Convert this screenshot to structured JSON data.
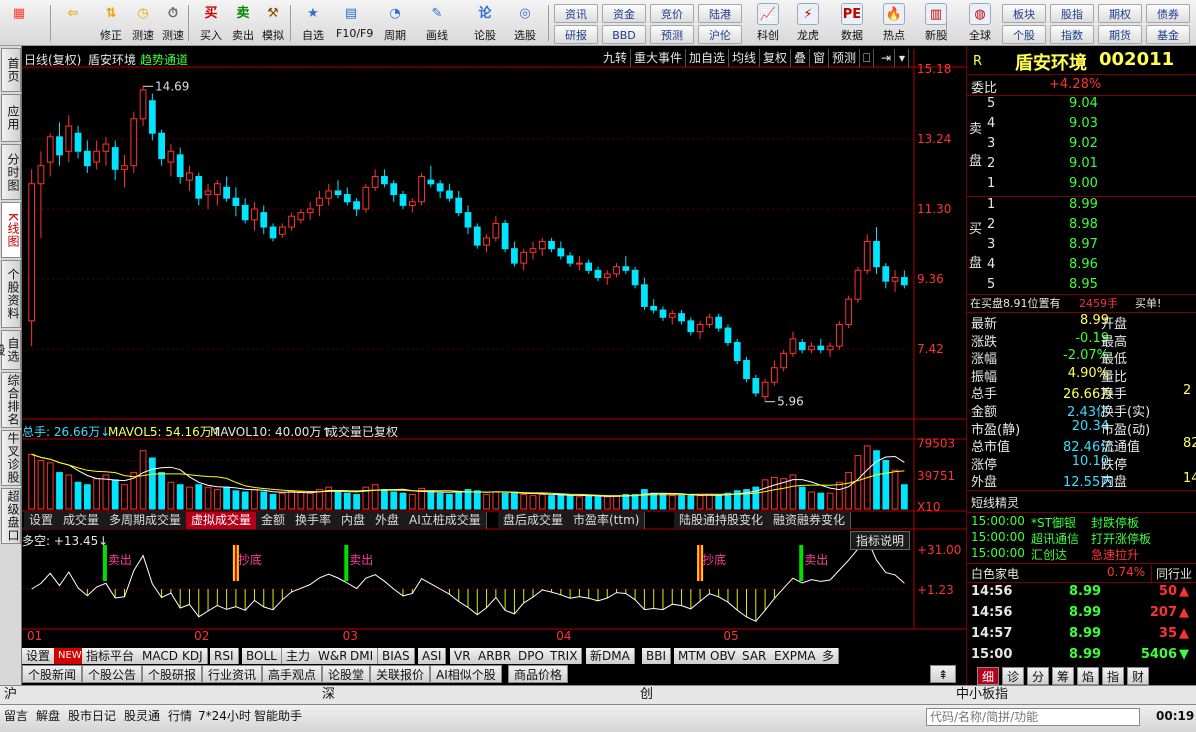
{
  "toolbar": {
    "buttons": [
      {
        "label": "",
        "icon": "grid-app-icon",
        "color": "#ff3b2f"
      },
      {
        "label": "",
        "icon": "back-arrow-icon",
        "color": "#f0a000"
      },
      {
        "label": "修正",
        "icon": "up-down-arrow-icon",
        "color": "#f0a000"
      },
      {
        "label": "测速",
        "icon": "clock-icon",
        "color": "#f0a000"
      },
      {
        "label": "测速",
        "icon": "stopwatch-icon",
        "color": "#606060"
      },
      {
        "label": "买入",
        "icon": "buy-icon",
        "color": "#d40000"
      },
      {
        "label": "卖出",
        "icon": "sell-icon",
        "color": "#008a00"
      },
      {
        "label": "模拟",
        "icon": "hammer-icon",
        "color": "#8a4a00"
      },
      {
        "label": "自选",
        "icon": "star-folder-icon",
        "color": "#2d6fd0"
      },
      {
        "label": "F10/F9",
        "icon": "f10-icon",
        "color": "#2d6fd0"
      },
      {
        "label": "周期",
        "icon": "cycle-icon",
        "color": "#2d6fd0"
      },
      {
        "label": "画线",
        "icon": "pencil-icon",
        "color": "#2d6fd0"
      },
      {
        "label": "论股",
        "icon": "discuss-icon",
        "color": "#2d6fd0"
      },
      {
        "label": "选股",
        "icon": "select-stock-icon",
        "color": "#2d6fd0"
      }
    ],
    "small_buttons": [
      "资讯",
      "资金",
      "竞价",
      "陆港",
      "研报",
      "BBD",
      "预测",
      "沪伦"
    ],
    "buttons2": [
      {
        "label": "科创",
        "icon": "kechuang-icon"
      },
      {
        "label": "龙虎",
        "icon": "dragon-tiger-icon"
      },
      {
        "label": "数据",
        "icon": "pe-data-icon"
      },
      {
        "label": "热点",
        "icon": "hotspot-icon"
      },
      {
        "label": "新股",
        "icon": "new-stock-icon"
      },
      {
        "label": "全球",
        "icon": "globe-icon"
      }
    ],
    "small_buttons2": [
      "板块",
      "股指",
      "期权",
      "债券",
      "个股",
      "指数",
      "期货",
      "基金"
    ]
  },
  "lefttabs": [
    "首页",
    "应用",
    "分时图",
    "K线图",
    "个股资料",
    "自选股",
    "综合排名",
    "牛叉诊股",
    "超级盘口"
  ],
  "chart": {
    "title": "日线(复权)",
    "stock": "盾安环境",
    "channel": "趋势通道",
    "top_buttons": [
      "九转",
      "重大事件",
      "加自选",
      "均线",
      "复权",
      "叠",
      "窗",
      "预测"
    ],
    "price_axis": [
      "15.18",
      "13.24",
      "11.30",
      "9.36",
      "7.42"
    ],
    "high_label": "14.69",
    "low_label": "5.96",
    "volume_header": {
      "total": "总手: 26.66万↓",
      "ma5": "MAVOL5: 54.16万↑",
      "ma10": "MAVOL10: 40.00万↑",
      "note": "成交量已复权"
    },
    "volume_axis": [
      "79503",
      "39751",
      "X10"
    ],
    "volume_tabs": [
      "设置",
      "成交量",
      "多周期成交量",
      "虚拟成交量",
      "金额",
      "换手率",
      "内盘",
      "外盘",
      "AI立桩成交量",
      "盘后成交量",
      "市盈率(ttm)",
      "陆股通持股变化",
      "融资融券变化"
    ],
    "active_volume_tab": "虚拟成交量",
    "indicator_header": "多空: +13.45↓",
    "indicator_help": "指标说明",
    "indicator_axis": [
      "+31.00",
      "+1.23"
    ],
    "signals": [
      "卖出",
      "抄底",
      "卖出",
      "抄底",
      "卖出"
    ],
    "months": [
      "01",
      "02",
      "03",
      "04",
      "05"
    ],
    "indicator_tabs": [
      "设置",
      "NEW",
      "指标平台",
      "MACD",
      "KDJ",
      "RSI",
      "BOLL",
      "主力",
      "W&R",
      "DMI",
      "BIAS",
      "ASI",
      "VR",
      "ARBR",
      "DPO",
      "TRIX",
      "新DMA",
      "BBI",
      "MTM",
      "OBV",
      "SAR",
      "EXPMA",
      "多"
    ],
    "colors": {
      "up": "#ff3232",
      "down": "#00e5ff",
      "axis": "#b40000",
      "ma5": "#ffffff",
      "ma10": "#ffff00"
    }
  },
  "candles": [
    [
      8.2,
      12.4,
      7.5,
      12.0
    ],
    [
      12.0,
      12.9,
      10.5,
      12.5
    ],
    [
      12.6,
      13.4,
      12.2,
      13.3
    ],
    [
      13.3,
      13.7,
      12.5,
      12.8
    ],
    [
      12.9,
      13.9,
      12.6,
      13.6
    ],
    [
      13.4,
      13.6,
      12.7,
      12.9
    ],
    [
      12.9,
      13.2,
      12.3,
      12.5
    ],
    [
      12.6,
      13.2,
      12.4,
      12.9
    ],
    [
      12.9,
      13.3,
      12.5,
      13.1
    ],
    [
      13.0,
      13.2,
      12.1,
      12.4
    ],
    [
      12.4,
      12.8,
      11.9,
      12.5
    ],
    [
      12.5,
      14.0,
      12.3,
      13.8
    ],
    [
      13.8,
      14.7,
      13.6,
      14.6
    ],
    [
      14.3,
      14.5,
      13.2,
      13.4
    ],
    [
      13.4,
      13.5,
      12.5,
      12.7
    ],
    [
      12.6,
      13.1,
      12.2,
      12.9
    ],
    [
      12.8,
      13.0,
      12.0,
      12.2
    ],
    [
      12.1,
      12.5,
      11.8,
      12.3
    ],
    [
      12.2,
      12.3,
      11.4,
      11.6
    ],
    [
      11.7,
      12.0,
      11.3,
      11.8
    ],
    [
      11.7,
      12.1,
      11.4,
      12.0
    ],
    [
      11.9,
      12.2,
      11.5,
      11.6
    ],
    [
      11.6,
      11.9,
      11.1,
      11.4
    ],
    [
      11.4,
      11.6,
      10.9,
      11.0
    ],
    [
      11.0,
      11.5,
      10.7,
      11.3
    ],
    [
      11.2,
      11.4,
      10.6,
      10.8
    ],
    [
      10.8,
      10.9,
      10.4,
      10.5
    ],
    [
      10.6,
      10.9,
      10.5,
      10.8
    ],
    [
      10.8,
      11.2,
      10.7,
      11.1
    ],
    [
      11.0,
      11.3,
      10.9,
      11.2
    ],
    [
      11.2,
      11.5,
      11.0,
      11.3
    ],
    [
      11.4,
      11.8,
      11.1,
      11.6
    ],
    [
      11.6,
      12.0,
      11.4,
      11.8
    ],
    [
      11.8,
      12.1,
      11.6,
      11.7
    ],
    [
      11.7,
      11.9,
      11.4,
      11.5
    ],
    [
      11.5,
      11.6,
      11.1,
      11.3
    ],
    [
      11.3,
      12.0,
      11.2,
      11.9
    ],
    [
      11.9,
      12.4,
      11.8,
      12.2
    ],
    [
      12.2,
      12.4,
      11.9,
      12.0
    ],
    [
      12.0,
      12.1,
      11.5,
      11.7
    ],
    [
      11.7,
      11.8,
      11.3,
      11.4
    ],
    [
      11.4,
      11.6,
      11.2,
      11.5
    ],
    [
      11.5,
      12.3,
      11.4,
      12.2
    ],
    [
      12.1,
      12.5,
      11.9,
      12.0
    ],
    [
      12.0,
      12.1,
      11.6,
      11.8
    ],
    [
      11.8,
      12.0,
      11.5,
      11.6
    ],
    [
      11.6,
      11.8,
      11.1,
      11.2
    ],
    [
      11.2,
      11.4,
      10.6,
      10.8
    ],
    [
      10.8,
      10.9,
      10.2,
      10.3
    ],
    [
      10.3,
      10.6,
      10.1,
      10.5
    ],
    [
      10.5,
      11.1,
      10.4,
      10.9
    ],
    [
      10.9,
      11.0,
      10.1,
      10.2
    ],
    [
      10.2,
      10.4,
      9.7,
      9.8
    ],
    [
      9.8,
      10.2,
      9.6,
      10.1
    ],
    [
      10.1,
      10.4,
      9.9,
      10.2
    ],
    [
      10.2,
      10.5,
      10.0,
      10.4
    ],
    [
      10.4,
      10.5,
      10.1,
      10.2
    ],
    [
      10.2,
      10.4,
      9.9,
      10.0
    ],
    [
      10.0,
      10.1,
      9.7,
      9.8
    ],
    [
      9.8,
      10.0,
      9.6,
      9.8
    ],
    [
      9.8,
      9.9,
      9.5,
      9.6
    ],
    [
      9.6,
      9.7,
      9.3,
      9.4
    ],
    [
      9.4,
      9.6,
      9.2,
      9.5
    ],
    [
      9.5,
      9.8,
      9.4,
      9.7
    ],
    [
      9.7,
      10.0,
      9.5,
      9.6
    ],
    [
      9.6,
      9.7,
      9.1,
      9.2
    ],
    [
      9.2,
      9.4,
      8.5,
      8.6
    ],
    [
      8.6,
      8.8,
      8.4,
      8.5
    ],
    [
      8.5,
      8.6,
      8.2,
      8.3
    ],
    [
      8.3,
      8.5,
      8.1,
      8.4
    ],
    [
      8.4,
      8.5,
      8.1,
      8.2
    ],
    [
      8.2,
      8.3,
      7.8,
      7.9
    ],
    [
      7.9,
      8.2,
      7.7,
      8.1
    ],
    [
      8.1,
      8.4,
      8.0,
      8.3
    ],
    [
      8.3,
      8.4,
      7.9,
      8.0
    ],
    [
      8.0,
      8.1,
      7.5,
      7.6
    ],
    [
      7.6,
      7.7,
      7.0,
      7.1
    ],
    [
      7.1,
      7.2,
      6.5,
      6.6
    ],
    [
      6.6,
      6.7,
      6.1,
      6.2
    ],
    [
      6.1,
      6.6,
      5.96,
      6.5
    ],
    [
      6.5,
      7.1,
      6.4,
      6.9
    ],
    [
      6.9,
      7.4,
      6.8,
      7.3
    ],
    [
      7.3,
      7.9,
      7.2,
      7.7
    ],
    [
      7.6,
      7.7,
      7.3,
      7.4
    ],
    [
      7.4,
      7.6,
      7.3,
      7.5
    ],
    [
      7.5,
      7.7,
      7.3,
      7.4
    ],
    [
      7.4,
      7.6,
      7.2,
      7.5
    ],
    [
      7.5,
      8.2,
      7.4,
      8.1
    ],
    [
      8.1,
      8.9,
      8.0,
      8.8
    ],
    [
      8.8,
      9.7,
      8.7,
      9.6
    ],
    [
      9.6,
      10.6,
      9.5,
      10.4
    ],
    [
      10.4,
      10.8,
      9.5,
      9.7
    ],
    [
      9.7,
      9.8,
      9.1,
      9.3
    ],
    [
      9.3,
      9.6,
      9.0,
      9.4
    ],
    [
      9.4,
      9.6,
      9.1,
      9.2
    ]
  ],
  "volumes": [
    45,
    40,
    38,
    30,
    28,
    22,
    20,
    25,
    28,
    24,
    20,
    30,
    48,
    42,
    30,
    22,
    20,
    18,
    20,
    18,
    16,
    18,
    15,
    14,
    16,
    14,
    12,
    13,
    15,
    14,
    13,
    16,
    18,
    15,
    13,
    12,
    18,
    20,
    16,
    14,
    13,
    12,
    17,
    15,
    13,
    12,
    14,
    16,
    15,
    12,
    14,
    13,
    14,
    12,
    11,
    12,
    11,
    12,
    11,
    10,
    11,
    10,
    10,
    11,
    12,
    12,
    16,
    13,
    12,
    11,
    11,
    12,
    11,
    12,
    11,
    13,
    15,
    16,
    18,
    24,
    26,
    25,
    28,
    18,
    14,
    13,
    13,
    22,
    30,
    44,
    52,
    48,
    40,
    32,
    20
  ],
  "quote": {
    "stock_name": "盾安环境",
    "stock_code": "002011",
    "r_label": "R",
    "weibi_label": "委比",
    "weibi": "+4.28%",
    "sell_label": "卖盘",
    "buy_label": "买盘",
    "sell": [
      [
        "5",
        "9.04"
      ],
      [
        "4",
        "9.03"
      ],
      [
        "3",
        "9.02"
      ],
      [
        "2",
        "9.01"
      ],
      [
        "1",
        "9.00"
      ]
    ],
    "buy": [
      [
        "1",
        "8.99"
      ],
      [
        "2",
        "8.98"
      ],
      [
        "3",
        "8.97"
      ],
      [
        "4",
        "8.96"
      ],
      [
        "5",
        "8.95"
      ]
    ],
    "position_note": "在买盘8.91位置有",
    "position_qty": "2459手",
    "position_tag": "买单!",
    "fields": [
      [
        "最新",
        "8.99",
        "开盘",
        ""
      ],
      [
        "涨跌",
        "-0.19",
        "最高",
        ""
      ],
      [
        "涨幅",
        "-2.07%",
        "最低",
        ""
      ],
      [
        "振幅",
        "4.90%",
        "量比",
        ""
      ],
      [
        "总手",
        "26.66万",
        "换手",
        "2"
      ],
      [
        "金额",
        "2.43亿",
        "换手(实)",
        ""
      ],
      [
        "市盈(静)",
        "20.34",
        "市盈(动)",
        ""
      ],
      [
        "总市值",
        "82.46亿",
        "流通值",
        "82"
      ],
      [
        "涨停",
        "10.10",
        "跌停",
        ""
      ],
      [
        "外盘",
        "12.55万",
        "内盘",
        "14"
      ]
    ],
    "short_title": "短线精灵",
    "short_list": [
      [
        "15:00:00",
        "*ST御银",
        "封跌停板"
      ],
      [
        "15:00:00",
        "超讯通信",
        "打开涨停板"
      ],
      [
        "15:00:00",
        "汇创达",
        "急速拉升"
      ]
    ],
    "sector": "白色家电",
    "sector_change": "0.74%",
    "sector_btn": "同行业",
    "ticks": [
      [
        "14:56",
        "8.99",
        "50"
      ],
      [
        "14:56",
        "8.99",
        "207"
      ],
      [
        "14:57",
        "8.99",
        "35"
      ],
      [
        "15:00",
        "8.99",
        "5406"
      ]
    ],
    "detail_tabs": [
      "细",
      "诊",
      "分",
      "筹",
      "焰",
      "指",
      "财"
    ]
  },
  "bottom_tabs": [
    "个股新闻",
    "个股公告",
    "个股研报",
    "行业资讯",
    "高手观点",
    "论股堂",
    "关联报价",
    "AI相似个股",
    "商品价格"
  ],
  "indexbar": [
    "沪",
    "深",
    "创",
    "中小板指"
  ],
  "statusbar": [
    "留言",
    "解盘",
    "股市日记",
    "股灵通",
    "行情",
    "7*24小时",
    "智能助手"
  ],
  "search_placeholder": "代码/名称/简拼/功能",
  "clock": "00:19"
}
